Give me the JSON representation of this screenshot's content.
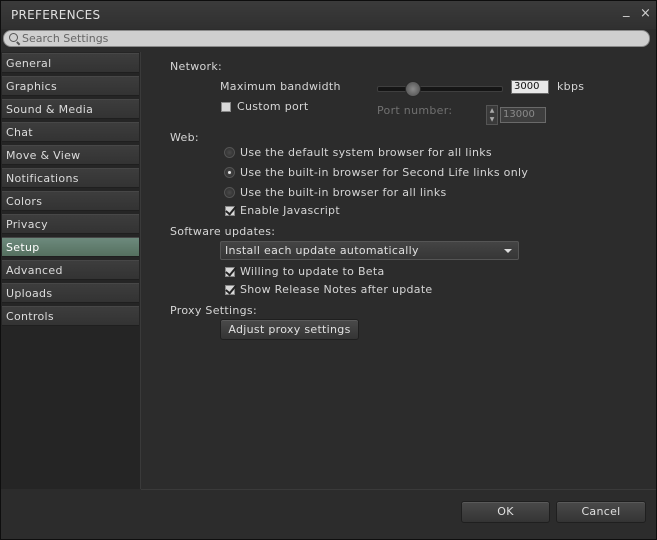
{
  "window": {
    "title": "PREFERENCES",
    "minimize": "_",
    "close": "×"
  },
  "search": {
    "placeholder": "Search Settings"
  },
  "sidebar": {
    "items": [
      {
        "label": "General"
      },
      {
        "label": "Graphics"
      },
      {
        "label": "Sound & Media"
      },
      {
        "label": "Chat"
      },
      {
        "label": "Move & View"
      },
      {
        "label": "Notifications"
      },
      {
        "label": "Colors"
      },
      {
        "label": "Privacy"
      },
      {
        "label": "Setup",
        "active": true
      },
      {
        "label": "Advanced"
      },
      {
        "label": "Uploads"
      },
      {
        "label": "Controls"
      }
    ]
  },
  "network": {
    "heading": "Network:",
    "bandwidth_label": "Maximum bandwidth",
    "bandwidth_value": "3000",
    "bandwidth_unit": "kbps",
    "custom_port_label": "Custom port",
    "custom_port_checked": false,
    "port_label": "Port number:",
    "port_value": "13000"
  },
  "web": {
    "heading": "Web:",
    "options": [
      {
        "label": "Use the default system browser for all links",
        "selected": false
      },
      {
        "label": "Use the built-in browser for Second Life links only",
        "selected": true
      },
      {
        "label": "Use the built-in browser for all links",
        "selected": false
      }
    ],
    "javascript_label": "Enable Javascript",
    "javascript_checked": true
  },
  "updates": {
    "heading": "Software updates:",
    "selected": "Install each update automatically",
    "beta_label": "Willing to update to Beta",
    "beta_checked": true,
    "notes_label": "Show Release Notes after update",
    "notes_checked": true
  },
  "proxy": {
    "heading": "Proxy Settings:",
    "button_label": "Adjust proxy settings"
  },
  "footer": {
    "ok_label": "OK",
    "cancel_label": "Cancel"
  }
}
